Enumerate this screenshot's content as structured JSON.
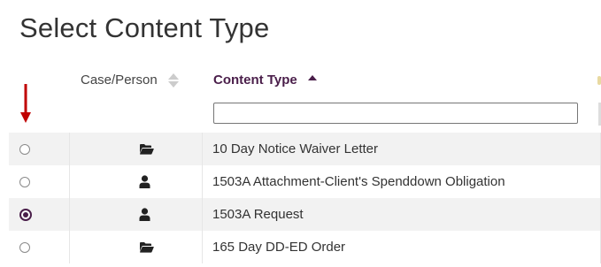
{
  "page": {
    "title": "Select Content Type"
  },
  "table": {
    "columns": {
      "case_person": "Case/Person",
      "content_type": "Content Type"
    },
    "filter": {
      "value": "",
      "placeholder": ""
    },
    "rows": [
      {
        "icon": "folder-open-icon",
        "content_type": "10 Day Notice Waiver Letter",
        "selected": false
      },
      {
        "icon": "person-icon",
        "content_type": "1503A Attachment-Client's Spenddown Obligation",
        "selected": false
      },
      {
        "icon": "person-icon",
        "content_type": "1503A Request",
        "selected": true
      },
      {
        "icon": "folder-open-icon",
        "content_type": "165 Day DD-ED Order",
        "selected": false
      }
    ]
  },
  "colors": {
    "accent": "#4a1e4a",
    "arrow": "#c00000",
    "row_stripe": "#f2f2f2"
  }
}
